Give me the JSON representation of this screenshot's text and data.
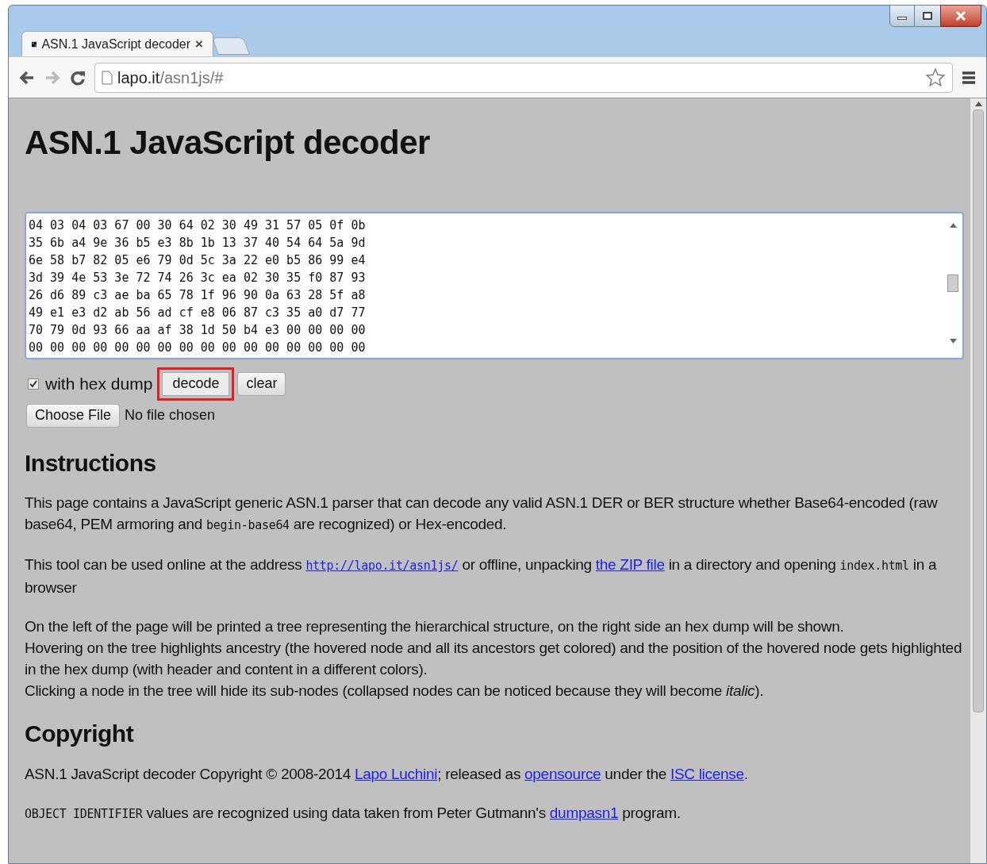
{
  "browser": {
    "tab": {
      "title": "ASN.1 JavaScript decoder",
      "close": "×"
    },
    "address": {
      "host": "lapo.it",
      "path": "/asn1js/#"
    }
  },
  "page": {
    "title": "ASN.1 JavaScript decoder",
    "hex_lines": [
      "04 03 04 03 67 00 30 64 02 30 49 31 57 05 0f 0b",
      "35 6b a4 9e 36 b5 e3 8b 1b 13 37 40 54 64 5a 9d",
      "6e 58 b7 82 05 e6 79 0d 5c 3a 22 e0 b5 86 99 e4",
      "3d 39 4e 53 3e 72 74 26 3c ea 02 30 35 f0 87 93",
      "26 d6 89 c3 ae ba 65 78 1f 96 90 0a 63 28 5f a8",
      "49 e1 e3 d2 ab 56 ad cf e8 06 87 c3 35 a0 d7 77",
      "70 79 0d 93 66 aa af 38 1d 50 b4 e3 00 00 00 00",
      "00 00 00 00 00 00 00 00 00 00 00 00 00 00 00 00"
    ],
    "hex_dump": {
      "label": "with hex dump",
      "checked": true
    },
    "buttons": [
      {
        "label": "decode",
        "highlighted": true
      },
      {
        "label": "clear",
        "highlighted": false
      }
    ],
    "file": {
      "button": "Choose File",
      "status": "No file chosen"
    },
    "sections": [
      {
        "heading": "Instructions",
        "paragraphs": [
          [
            {
              "kind": "text",
              "text": "This page contains a JavaScript generic ASN.1 parser that can decode any valid ASN.1 DER or BER structure whether Base64-encoded (raw base64, PEM armoring and "
            },
            {
              "kind": "code",
              "text": "begin-base64"
            },
            {
              "kind": "text",
              "text": " are recognized) or Hex-encoded."
            }
          ],
          [
            {
              "kind": "text",
              "text": "This tool can be used online at the address "
            },
            {
              "kind": "codelink",
              "text": "http://lapo.it/asn1js/"
            },
            {
              "kind": "text",
              "text": " or offline, unpacking "
            },
            {
              "kind": "link",
              "text": "the ZIP file"
            },
            {
              "kind": "text",
              "text": " in a directory and opening "
            },
            {
              "kind": "code",
              "text": "index.html"
            },
            {
              "kind": "text",
              "text": " in a browser"
            }
          ],
          [
            {
              "kind": "text",
              "text": "On the left of the page will be printed a tree representing the hierarchical structure, on the right side an hex dump will be shown."
            },
            {
              "kind": "break"
            },
            {
              "kind": "text",
              "text": "Hovering on the tree highlights ancestry (the hovered node and all its ancestors get colored) and the position of the hovered node gets highlighted in the hex dump (with header and content in a different colors)."
            },
            {
              "kind": "break"
            },
            {
              "kind": "text",
              "text": "Clicking a node in the tree will hide its sub-nodes (collapsed nodes can be noticed because they will become "
            },
            {
              "kind": "italic",
              "text": "italic"
            },
            {
              "kind": "text",
              "text": ")."
            }
          ]
        ]
      },
      {
        "heading": "Copyright",
        "paragraphs": [
          [
            {
              "kind": "text",
              "text": "ASN.1 JavaScript decoder Copyright © 2008-2014 "
            },
            {
              "kind": "link",
              "text": "Lapo Luchini"
            },
            {
              "kind": "text",
              "text": "; released as "
            },
            {
              "kind": "link",
              "text": "opensource"
            },
            {
              "kind": "text",
              "text": " under the "
            },
            {
              "kind": "link",
              "text": "ISC license"
            },
            {
              "kind": "text",
              "text": "."
            }
          ],
          [
            {
              "kind": "code",
              "text": "OBJECT IDENTIFIER"
            },
            {
              "kind": "text",
              "text": " values are recognized using data taken from Peter Gutmann's "
            },
            {
              "kind": "link",
              "text": "dumpasn1"
            },
            {
              "kind": "text",
              "text": " program."
            }
          ]
        ]
      }
    ]
  }
}
